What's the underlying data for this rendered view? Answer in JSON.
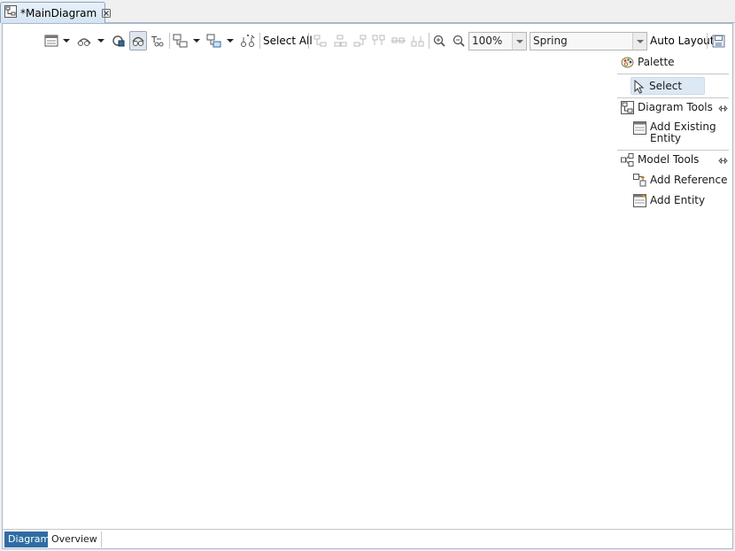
{
  "tab": {
    "title": "*MainDiagram",
    "icon": "diagram-icon"
  },
  "toolbar": {
    "select_all": "Select All",
    "zoom_value": "100%",
    "layout_value": "Spring",
    "auto_layout": "Auto Layout"
  },
  "palette": {
    "title": "Palette",
    "select": "Select",
    "diagram_tools": {
      "title": "Diagram Tools",
      "items": [
        "Add Existing",
        "Entity"
      ]
    },
    "model_tools": {
      "title": "Model Tools",
      "items": [
        "Add Reference",
        "Add Entity"
      ]
    }
  },
  "bottom_tabs": [
    "Diagram",
    "Overview"
  ],
  "colors": {
    "accent": "#2f6ca3",
    "selection": "#dde8f5",
    "border": "#a8b8cc"
  }
}
